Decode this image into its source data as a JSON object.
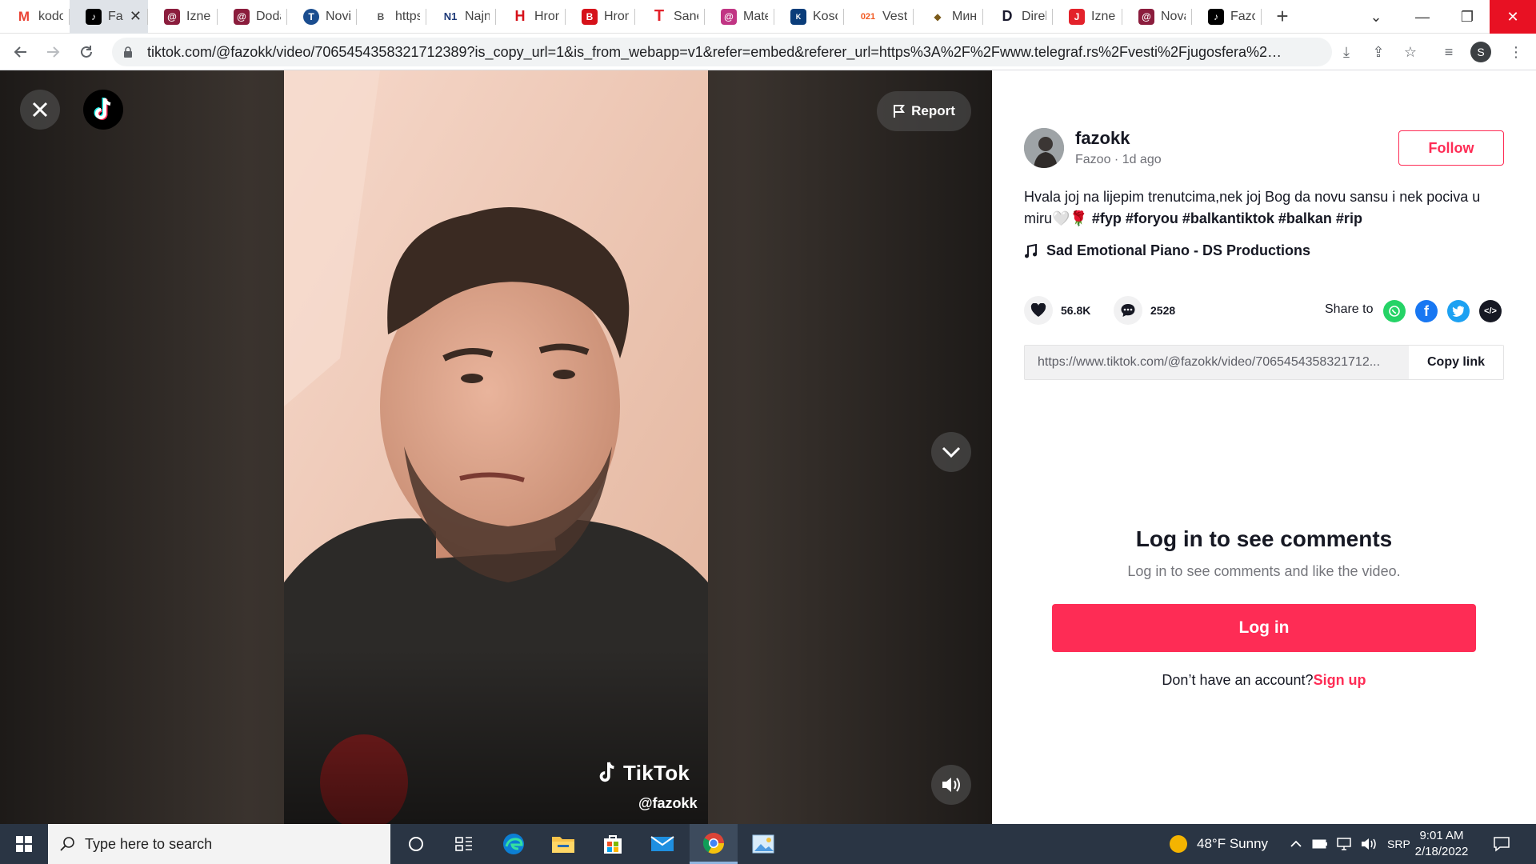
{
  "browser": {
    "tabs": [
      {
        "title": "kodo",
        "favicon": "gmail-icon",
        "color": "#ea4335",
        "glyph": "M",
        "active": false
      },
      {
        "title": "Fa",
        "favicon": "tiktok-icon",
        "color": "#000000",
        "glyph": "♪",
        "active": true
      },
      {
        "title": "Iznen",
        "favicon": "instagram-icon",
        "color": "#8b1d3d",
        "glyph": "@",
        "active": false
      },
      {
        "title": "Doda",
        "favicon": "instagram-icon",
        "color": "#8b1d3d",
        "glyph": "@",
        "active": false
      },
      {
        "title": "Novir",
        "favicon": "news-icon",
        "color": "#1a4d8f",
        "glyph": "T",
        "active": false
      },
      {
        "title": "https:",
        "favicon": "page-icon",
        "color": "#555555",
        "glyph": "B",
        "active": false
      },
      {
        "title": "Najnc",
        "favicon": "n1-icon",
        "color": "#1e3a78",
        "glyph": "N1",
        "active": false
      },
      {
        "title": "Hroni",
        "favicon": "hronika-icon",
        "color": "#d6111a",
        "glyph": "H",
        "active": false
      },
      {
        "title": "Hroni",
        "favicon": "blic-icon",
        "color": "#d6111a",
        "glyph": "B",
        "active": false
      },
      {
        "title": "Sanel",
        "favicon": "telegraf-icon",
        "color": "#e3222b",
        "glyph": "T",
        "active": false
      },
      {
        "title": "Matej",
        "favicon": "instagram-icon",
        "color": "#c13584",
        "glyph": "@",
        "active": false
      },
      {
        "title": "Kosov",
        "favicon": "news-icon",
        "color": "#0a3d7a",
        "glyph": "K",
        "active": false
      },
      {
        "title": "Vesti",
        "favicon": "021-icon",
        "color": "#f15a22",
        "glyph": "021",
        "active": false
      },
      {
        "title": "Мини",
        "favicon": "emblem-icon",
        "color": "#7a5a1a",
        "glyph": "◆",
        "active": false
      },
      {
        "title": "Direk",
        "favicon": "direktno-icon",
        "color": "#1a1a2e",
        "glyph": "D",
        "active": false
      },
      {
        "title": "Iznen",
        "favicon": "telegraf-icon",
        "color": "#e3222b",
        "glyph": "J",
        "active": false
      },
      {
        "title": "Nova",
        "favicon": "instagram-icon",
        "color": "#8b1d3d",
        "glyph": "@",
        "active": false
      },
      {
        "title": "Fazoc",
        "favicon": "tiktok-icon",
        "color": "#000000",
        "glyph": "♪",
        "active": false
      }
    ],
    "url": "tiktok.com/@fazokk/video/7065454358321712389?is_copy_url=1&is_from_webapp=v1&refer=embed&referer_url=https%3A%2F%2Fwww.telegraf.rs%2Fvesti%2Fjugosfera%2F3459977-emot...",
    "profile_initial": "S"
  },
  "video": {
    "report_label": "Report",
    "watermark_brand": "TikTok",
    "watermark_user": "@fazokk"
  },
  "post": {
    "username": "fazokk",
    "subline": "Fazoo · 1d ago",
    "follow_label": "Follow",
    "description": "Hvala joj na lijepim trenutcima,nek joj Bog da novu sansu i nek pociva u miru🤍🌹 ",
    "hashtags": "#fyp #foryou #balkantiktok #balkan #rip",
    "music": "Sad Emotional Piano - DS Productions",
    "likes": "56.8K",
    "comments": "2528",
    "share_label": "Share to",
    "link": "https://www.tiktok.com/@fazokk/video/7065454358321712...",
    "copy_label": "Copy link",
    "comments_title": "Log in to see comments",
    "comments_sub": "Log in to see comments and like the video.",
    "login_label": "Log in",
    "signup_prompt": "Don’t have an account?",
    "signup_label": "Sign up",
    "brand_color": "#fe2c55"
  },
  "taskbar": {
    "search_placeholder": "Type here to search",
    "weather": "48°F  Sunny",
    "language": "SRP",
    "time": "9:01 AM",
    "date": "2/18/2022"
  }
}
